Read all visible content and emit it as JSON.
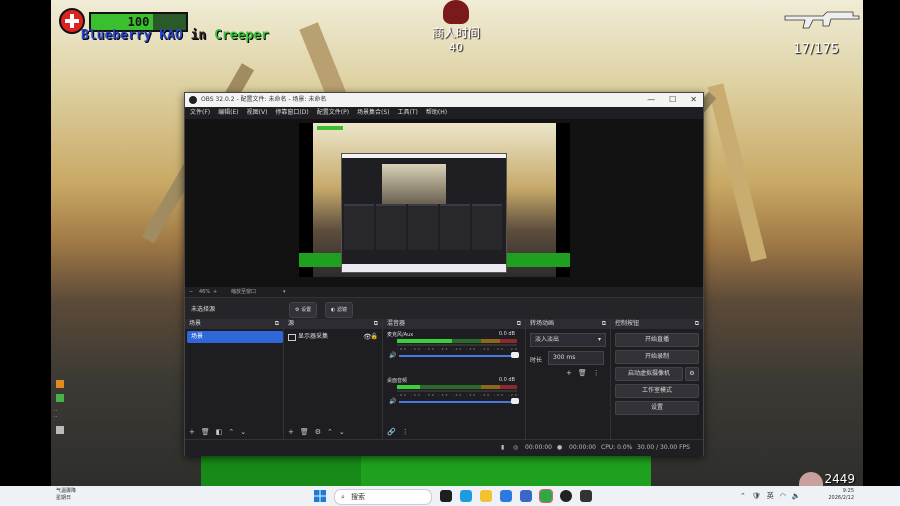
{
  "game": {
    "health": "100",
    "health_level": 0.65,
    "killfeed": {
      "killer": "Blueberry KAO",
      "word": "in",
      "victim": "Creeper"
    },
    "shop_label": "商人时间",
    "timer": "40",
    "ammo": "17/175",
    "score": "2449"
  },
  "obs": {
    "title": "OBS 32.0.2 - 配置文件: 未命名 - 场景: 未命名",
    "menu": [
      "文件(F)",
      "编辑(E)",
      "视图(V)",
      "停靠窗口(D)",
      "配置文件(P)",
      "场景集合(S)",
      "工具(T)",
      "帮助(H)"
    ],
    "zoom": "46%",
    "zoom_mode": "缩放至窗口",
    "no_source": "未选择源",
    "props_btn": "设置",
    "filters_btn": "滤镜",
    "docks": {
      "scenes": "场景",
      "sources": "源",
      "mixer": "混音器",
      "transitions": "转场动画",
      "controls": "控制按钮"
    },
    "scene_item": "场景",
    "source_item": "显示器采集",
    "mixer_tracks": [
      {
        "name": "麦克风/Aux",
        "db": "0.0 dB",
        "level": 0.46
      },
      {
        "name": "桌面音频",
        "db": "0.0 dB",
        "level": 0.19
      }
    ],
    "mixer_scale": "-60 -55 -50 -45 -40 -35 -30 -25 -20 -15 -10 -5 0",
    "transition": "淡入淡出",
    "duration_label": "时长",
    "duration": "300 ms",
    "controls": [
      "开始直播",
      "开始录制",
      "启动虚拟摄像机",
      "工作室模式",
      "设置"
    ],
    "status": {
      "stream_time": "00:00:00",
      "rec_time": "00:00:00",
      "cpu": "CPU: 0.0%",
      "fps": "30.00 / 30.00 FPS"
    }
  },
  "taskbar": {
    "weather_top": "气温骤降",
    "weather_bottom": "星期日",
    "search": "搜索",
    "tray_lang": "英",
    "time": "9:25",
    "date": "2026/2/12"
  },
  "colors": {
    "obs_bg": "#1f1f23",
    "accent": "#2f66d8",
    "hud_green": "#3bbf2f",
    "kill_blue": "#2b46c8"
  }
}
